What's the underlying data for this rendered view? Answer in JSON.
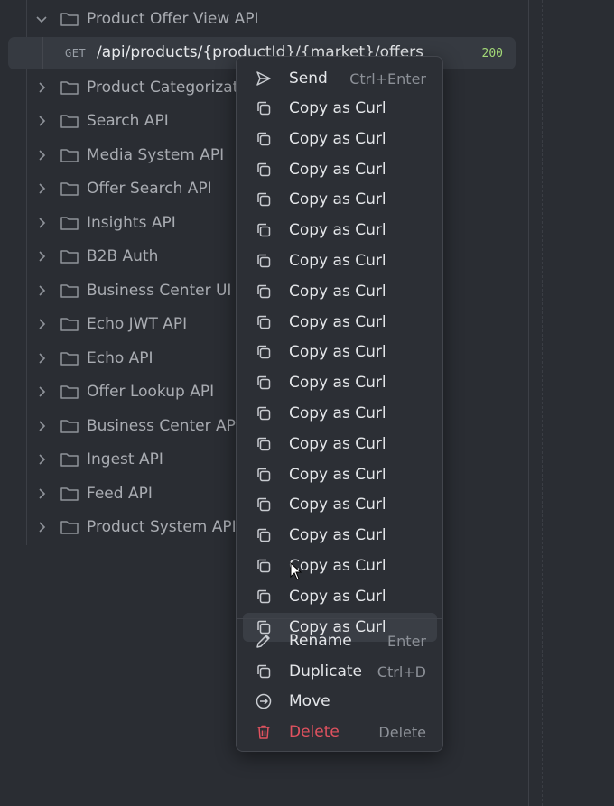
{
  "tree": {
    "expanded_folder": "Product Offer View API",
    "request": {
      "method": "GET",
      "path": "/api/products/{productId}/{market}/offers",
      "status": "200"
    },
    "folders": [
      "Product Categorizati",
      "Search API",
      "Media System API",
      "Offer Search API",
      "Insights API",
      "B2B Auth",
      "Business Center UI",
      "Echo JWT API",
      "Echo API",
      "Offer Lookup API",
      "Business Center API",
      "Ingest API",
      "Feed API",
      "Product System API"
    ]
  },
  "context_menu": {
    "send": {
      "label": "Send",
      "shortcut": "Ctrl+Enter",
      "icon": "send-icon"
    },
    "copy_items": [
      "Copy as Curl",
      "Copy as Curl",
      "Copy as Curl",
      "Copy as Curl",
      "Copy as Curl",
      "Copy as Curl",
      "Copy as Curl",
      "Copy as Curl",
      "Copy as Curl",
      "Copy as Curl",
      "Copy as Curl",
      "Copy as Curl",
      "Copy as Curl",
      "Copy as Curl",
      "Copy as Curl",
      "Copy as Curl",
      "Copy as Curl",
      "Copy as Curl"
    ],
    "hovered_copy_index": 17,
    "rename": {
      "label": "Rename",
      "shortcut": "Enter",
      "icon": "pencil-icon"
    },
    "duplicate": {
      "label": "Duplicate",
      "shortcut": "Ctrl+D",
      "icon": "copy-icon"
    },
    "move": {
      "label": "Move",
      "shortcut": "",
      "icon": "arrow-circle-icon"
    },
    "delete": {
      "label": "Delete",
      "shortcut": "Delete",
      "icon": "trash-icon"
    }
  },
  "colors": {
    "background": "#2a2d33",
    "menu": "#2c2f35",
    "danger": "#e0525f",
    "status_ok": "#a3d977"
  }
}
